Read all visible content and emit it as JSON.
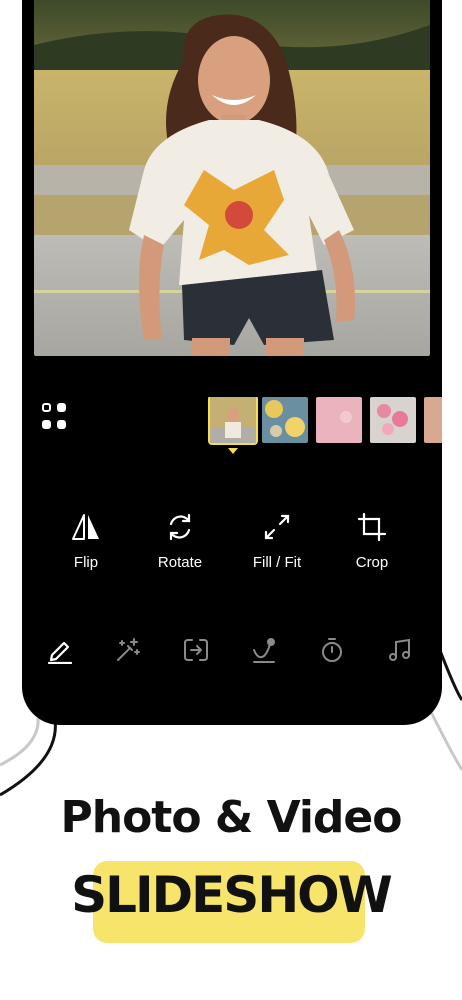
{
  "colors": {
    "accent": "#f4e04d",
    "highlight": "#f7e46a",
    "phone_bg": "#000000",
    "text": "#111111"
  },
  "photo": {
    "subject": "smiling woman on road"
  },
  "thumbnails": [
    {
      "name": "woman-portrait",
      "active": true
    },
    {
      "name": "food-table",
      "active": false
    },
    {
      "name": "pink-texture",
      "active": false
    },
    {
      "name": "pink-flowers",
      "active": false
    },
    {
      "name": "partial-thumb",
      "active": false
    }
  ],
  "tools": [
    {
      "icon": "flip-icon",
      "label": "Flip"
    },
    {
      "icon": "rotate-icon",
      "label": "Rotate"
    },
    {
      "icon": "fill-fit-icon",
      "label": "Fill / Fit"
    },
    {
      "icon": "crop-icon",
      "label": "Crop"
    }
  ],
  "tabs": [
    {
      "icon": "edit-pencil-icon",
      "active": true
    },
    {
      "icon": "magic-wand-icon",
      "active": false
    },
    {
      "icon": "transition-icon",
      "active": false
    },
    {
      "icon": "motion-path-icon",
      "active": false
    },
    {
      "icon": "timer-icon",
      "active": false
    },
    {
      "icon": "music-note-icon",
      "active": false
    }
  ],
  "headline": {
    "line1": "Photo & Video",
    "line2": "SLIDESHOW"
  }
}
